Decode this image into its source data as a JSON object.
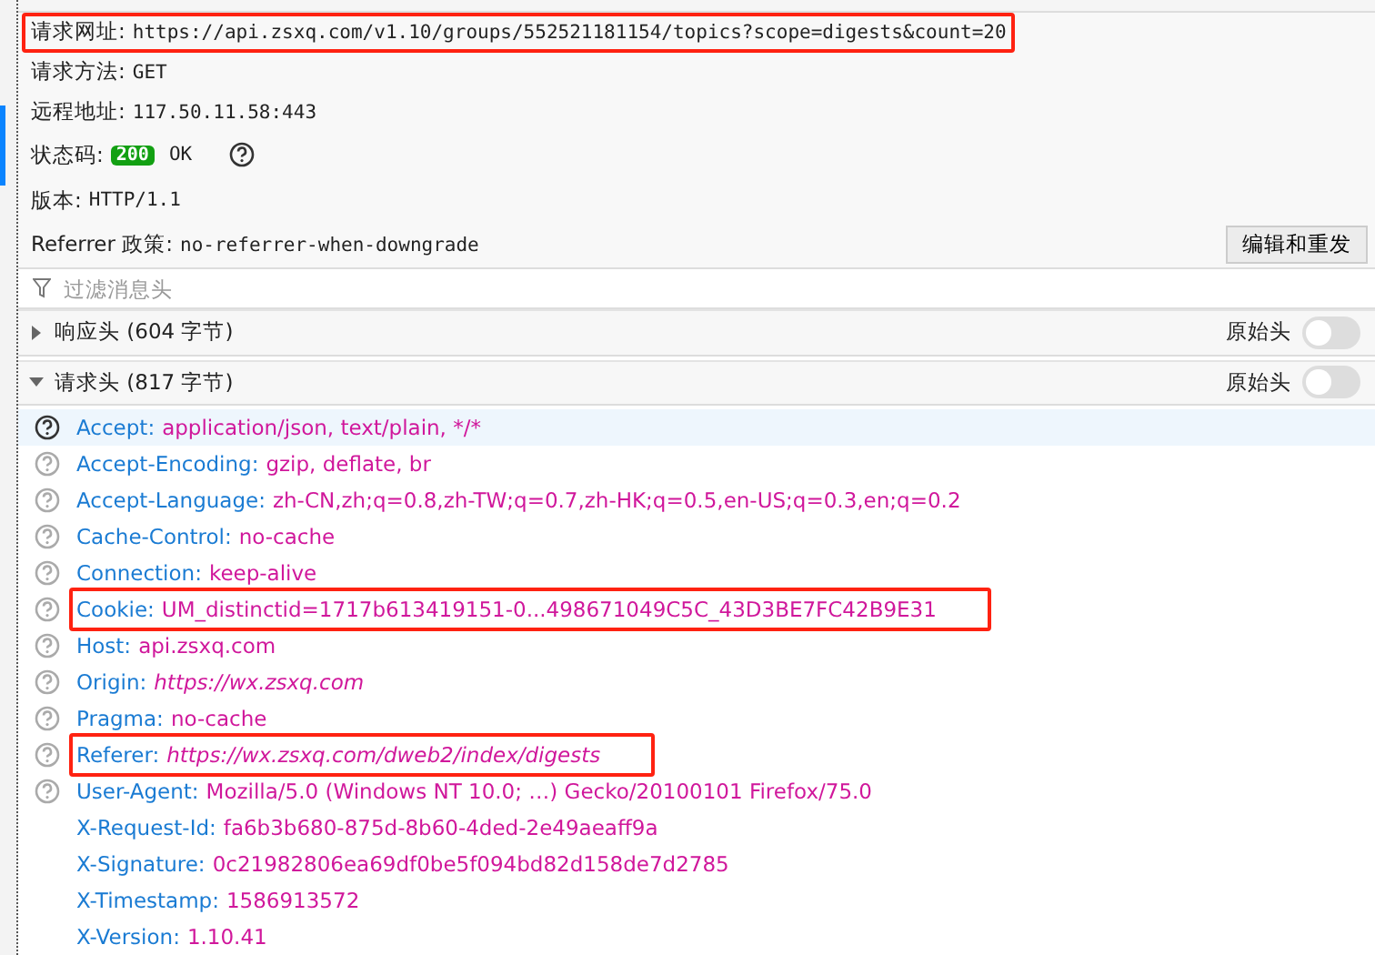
{
  "summary": [
    {
      "label": "请求网址:",
      "value": "https://api.zsxq.com/v1.10/groups/552521181154/topics?scope=digests&count=20",
      "highlighted": true
    },
    {
      "label": "请求方法:",
      "value": "GET",
      "highlighted": false
    },
    {
      "label": "远程地址:",
      "value": "117.50.11.58:443",
      "highlighted": false
    }
  ],
  "status": {
    "label": "状态码:",
    "code": "200",
    "text": "OK"
  },
  "version": {
    "label": "版本:",
    "value": "HTTP/1.1"
  },
  "referrer_policy": {
    "label": "Referrer 政策:",
    "value": "no-referrer-when-downgrade"
  },
  "resend_button": "编辑和重发",
  "filter": {
    "placeholder": "过滤消息头"
  },
  "sections": [
    {
      "title": "响应头 (604 字节)",
      "expanded": false,
      "raw_label": "原始头",
      "raw_on": false
    },
    {
      "title": "请求头 (817 字节)",
      "expanded": true,
      "raw_label": "原始头",
      "raw_on": false
    }
  ],
  "headers": [
    {
      "name": "Accept:",
      "value": "application/json, text/plain, */*",
      "kind": "text",
      "help": true,
      "selected": true,
      "highlighted": false
    },
    {
      "name": "Accept-Encoding:",
      "value": "gzip, deflate, br",
      "kind": "text",
      "help": true,
      "selected": false,
      "highlighted": false
    },
    {
      "name": "Accept-Language:",
      "value": "zh-CN,zh;q=0.8,zh-TW;q=0.7,zh-HK;q=0.5,en-US;q=0.3,en;q=0.2",
      "kind": "text",
      "help": true,
      "selected": false,
      "highlighted": false
    },
    {
      "name": "Cache-Control:",
      "value": "no-cache",
      "kind": "text",
      "help": true,
      "selected": false,
      "highlighted": false
    },
    {
      "name": "Connection:",
      "value": "keep-alive",
      "kind": "text",
      "help": true,
      "selected": false,
      "highlighted": false
    },
    {
      "name": "Cookie:",
      "value": "UM_distinctid=1717b613419151-0...498671049C5C_43D3BE7FC42B9E31",
      "kind": "text",
      "help": true,
      "selected": false,
      "highlighted": true
    },
    {
      "name": "Host:",
      "value": "api.zsxq.com",
      "kind": "text",
      "help": true,
      "selected": false,
      "highlighted": false
    },
    {
      "name": "Origin:",
      "value": "https://wx.zsxq.com",
      "kind": "url",
      "help": true,
      "selected": false,
      "highlighted": false
    },
    {
      "name": "Pragma:",
      "value": "no-cache",
      "kind": "text",
      "help": true,
      "selected": false,
      "highlighted": false
    },
    {
      "name": "Referer:",
      "value": "https://wx.zsxq.com/dweb2/index/digests",
      "kind": "url",
      "help": true,
      "selected": false,
      "highlighted": true
    },
    {
      "name": "User-Agent:",
      "value": "Mozilla/5.0 (Windows NT 10.0; …) Gecko/20100101 Firefox/75.0",
      "kind": "text",
      "help": true,
      "selected": false,
      "highlighted": false
    },
    {
      "name": "X-Request-Id:",
      "value": "fa6b3b680-875d-8b60-4ded-2e49aeaff9a",
      "kind": "text",
      "help": false,
      "selected": false,
      "highlighted": false
    },
    {
      "name": "X-Signature:",
      "value": "0c21982806ea69df0be5f094bd82d158de7d2785",
      "kind": "text",
      "help": false,
      "selected": false,
      "highlighted": false
    },
    {
      "name": "X-Timestamp:",
      "value": "1586913572",
      "kind": "text",
      "help": false,
      "selected": false,
      "highlighted": false
    },
    {
      "name": "X-Version:",
      "value": "1.10.41",
      "kind": "text",
      "help": false,
      "selected": false,
      "highlighted": false
    }
  ]
}
